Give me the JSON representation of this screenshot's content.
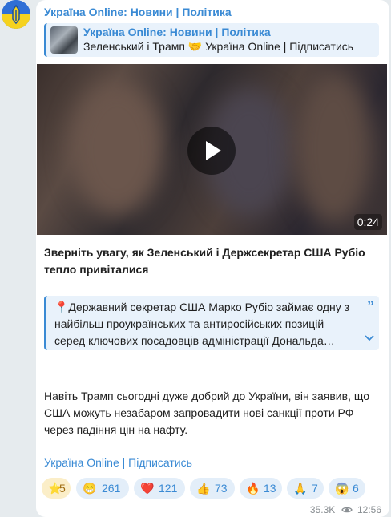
{
  "post": {
    "channel_name": "Україна Online: Новини | Політика",
    "forward": {
      "title": "Україна Online: Новини | Політика",
      "text": "Зеленський і Трамп 🤝 Україна Online | Підписатись"
    },
    "video": {
      "duration": "0:24",
      "play_icon": "play-icon"
    },
    "headline": "Зверніть увагу, як Зеленський і Держсекретар США Рубіо тепло привіталися",
    "quote": "📍Державний секретар США Марко Рубіо займає одну з найбільш проукраїнських та антиросійських позицій серед ключових посадовців адміністрації Дональда…",
    "body": "Навіть Трамп сьогодні дуже добрий до України, він заявив, що США можуть незабаром запровадити нові санкції проти РФ через падіння цін на нафту.",
    "subscribe_link": "Україна Online | Підписатись",
    "reactions": [
      {
        "emoji": "⭐",
        "count": "5"
      },
      {
        "emoji": "😁",
        "count": "261"
      },
      {
        "emoji": "❤️",
        "count": "121"
      },
      {
        "emoji": "👍",
        "count": "73"
      },
      {
        "emoji": "🔥",
        "count": "13"
      },
      {
        "emoji": "🙏",
        "count": "7"
      },
      {
        "emoji": "😱",
        "count": "6"
      }
    ],
    "views": "35.3K",
    "time": "12:56"
  },
  "colors": {
    "accent": "#3a8ad4",
    "background": "#e6ebee",
    "bubble": "#ffffff"
  }
}
